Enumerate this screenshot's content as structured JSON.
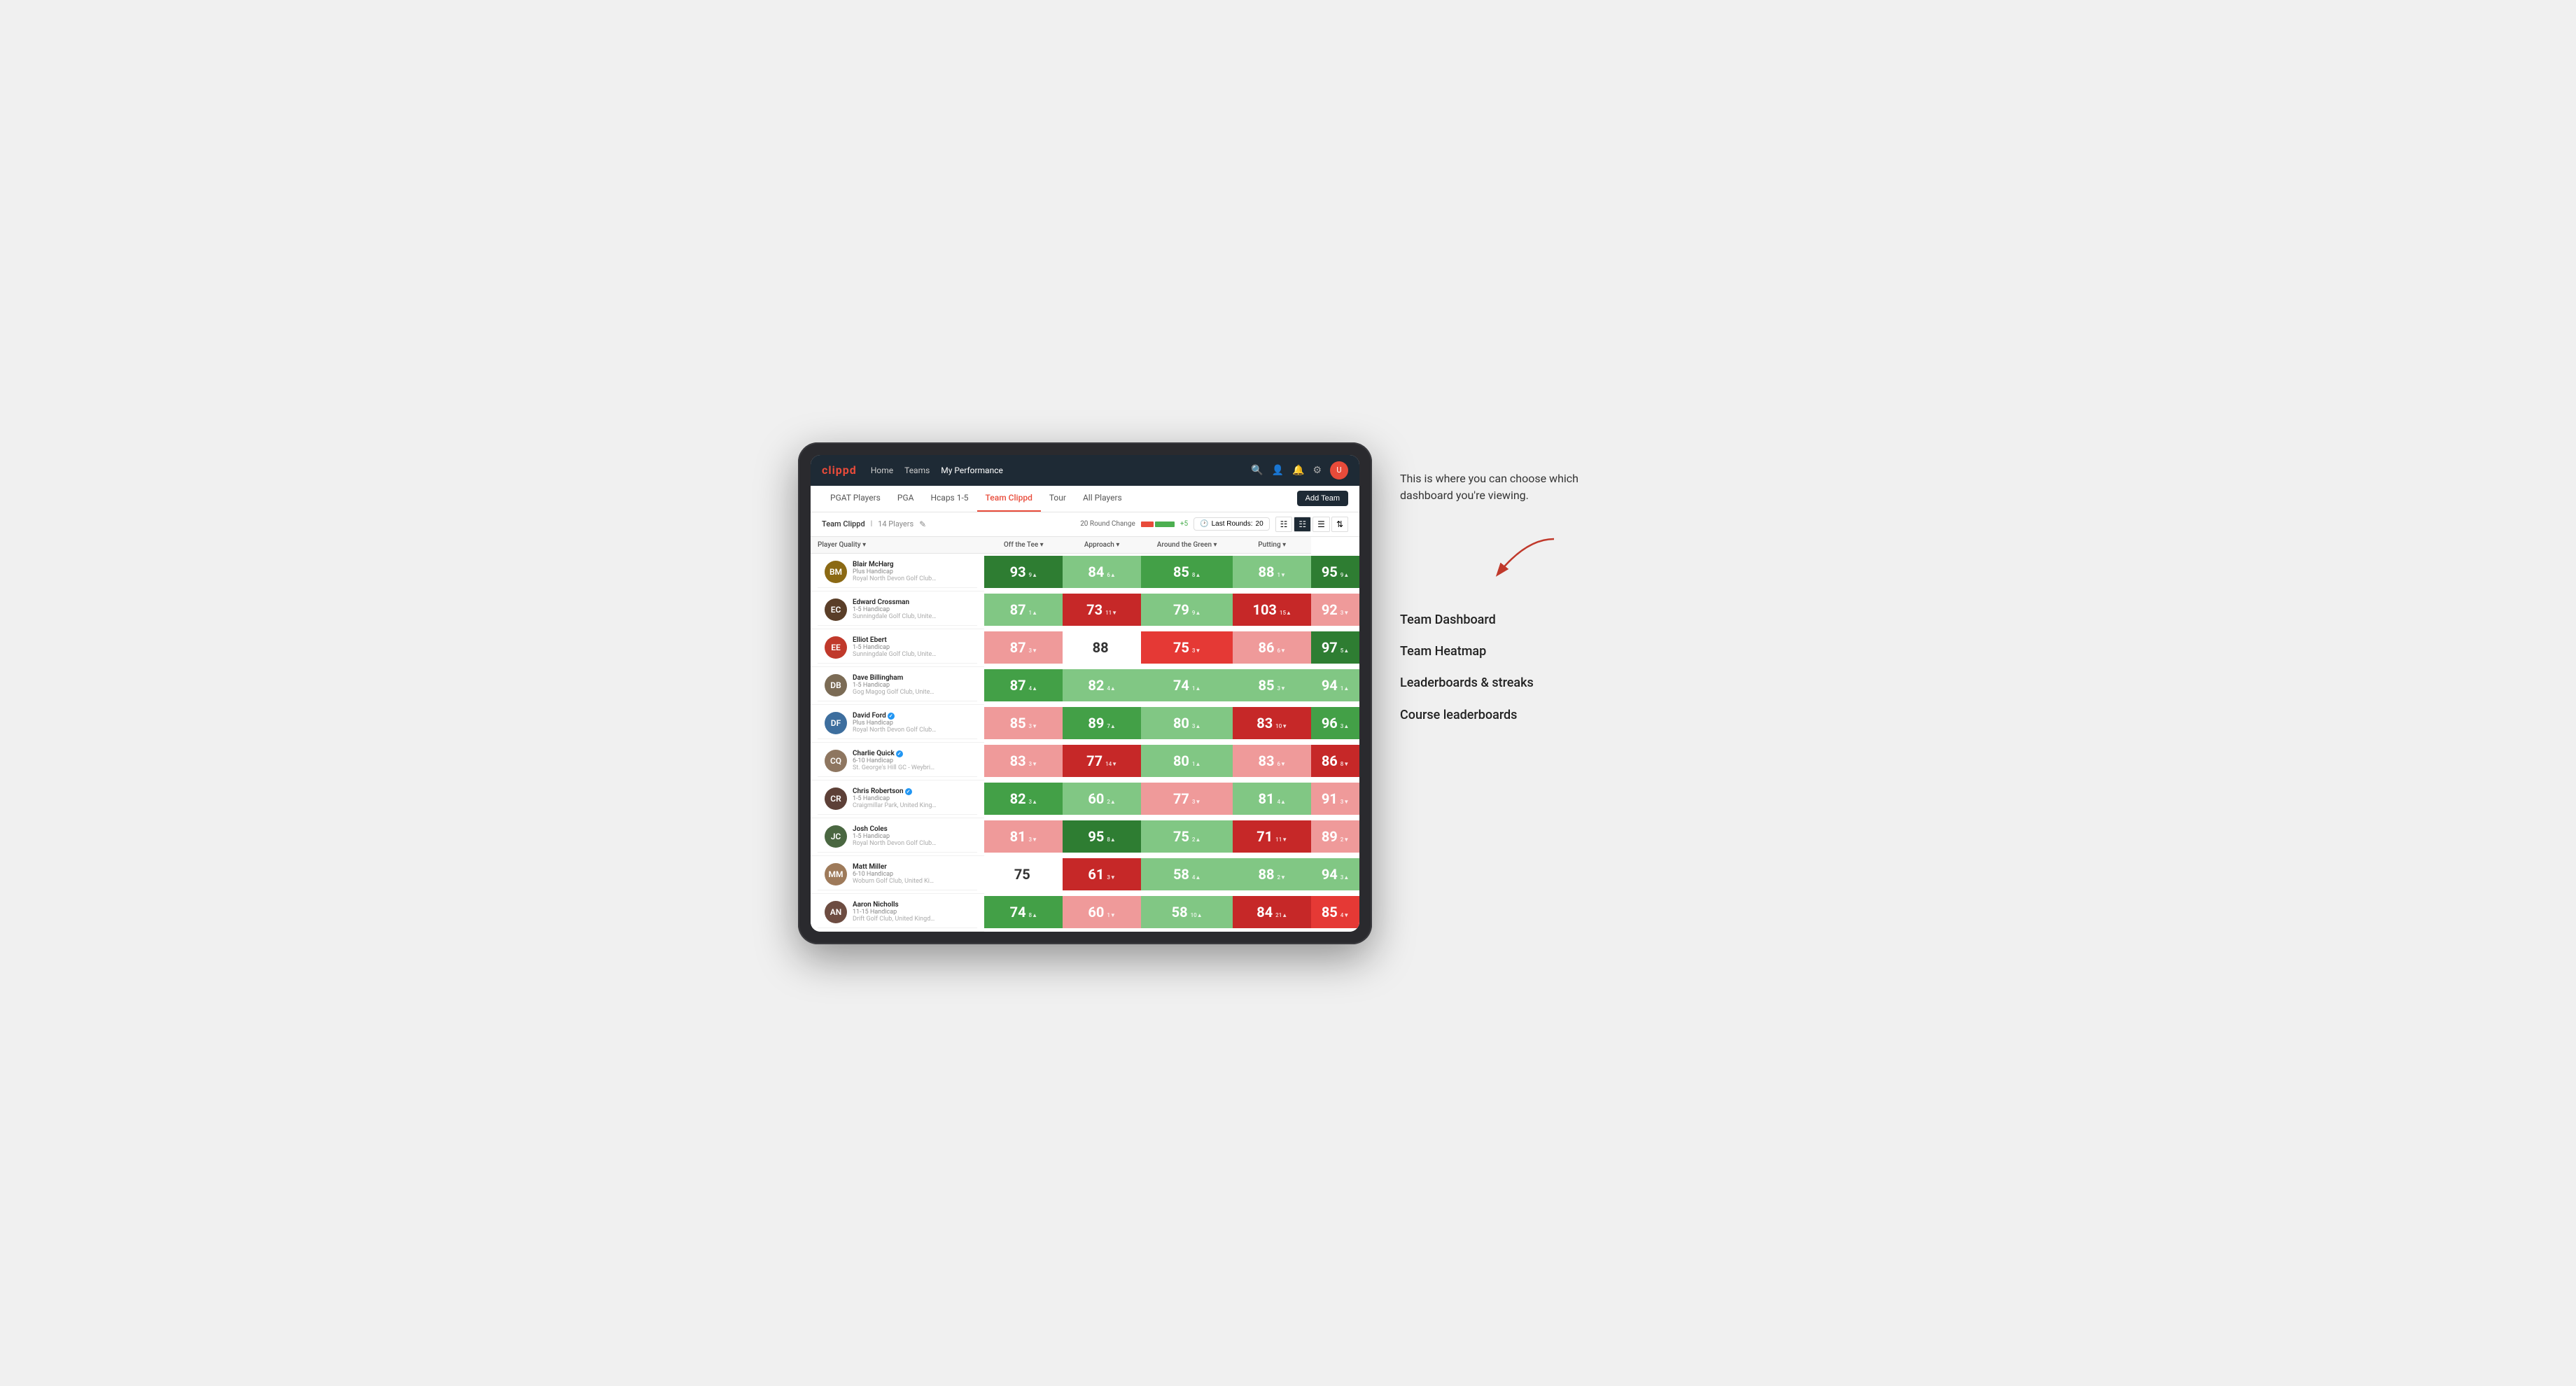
{
  "annotation": {
    "description": "This is where you can choose which dashboard you're viewing.",
    "items": [
      "Team Dashboard",
      "Team Heatmap",
      "Leaderboards & streaks",
      "Course leaderboards"
    ]
  },
  "nav": {
    "logo": "clippd",
    "links": [
      "Home",
      "Teams",
      "My Performance"
    ],
    "active_link": "My Performance"
  },
  "sub_nav": {
    "tabs": [
      "PGAT Players",
      "PGA",
      "Hcaps 1-5",
      "Team Clippd",
      "Tour",
      "All Players"
    ],
    "active_tab": "Team Clippd",
    "add_team_label": "Add Team"
  },
  "team_header": {
    "team_name": "Team Clippd",
    "player_count": "14 Players",
    "round_change_label": "20 Round Change",
    "round_change_neg": "-5",
    "round_change_pos": "+5",
    "last_rounds_label": "Last Rounds:",
    "last_rounds_value": "20"
  },
  "table": {
    "col_headers": [
      "Player Quality ▾",
      "Off the Tee ▾",
      "Approach ▾",
      "Around the Green ▾",
      "Putting ▾"
    ],
    "players": [
      {
        "name": "Blair McHarg",
        "handicap": "Plus Handicap",
        "club": "Royal North Devon Golf Club, United Kingdom",
        "avatar_color": "#8B6914",
        "scores": [
          {
            "value": "93",
            "change": "9",
            "dir": "up",
            "bg": "green-dark"
          },
          {
            "value": "84",
            "change": "6",
            "dir": "up",
            "bg": "green-light"
          },
          {
            "value": "85",
            "change": "8",
            "dir": "up",
            "bg": "green-med"
          },
          {
            "value": "88",
            "change": "1",
            "dir": "down",
            "bg": "green-light"
          },
          {
            "value": "95",
            "change": "9",
            "dir": "up",
            "bg": "green-dark"
          }
        ]
      },
      {
        "name": "Edward Crossman",
        "handicap": "1-5 Handicap",
        "club": "Sunningdale Golf Club, United Kingdom",
        "avatar_color": "#5a3e28",
        "scores": [
          {
            "value": "87",
            "change": "1",
            "dir": "up",
            "bg": "green-light"
          },
          {
            "value": "73",
            "change": "11",
            "dir": "down",
            "bg": "red-dark"
          },
          {
            "value": "79",
            "change": "9",
            "dir": "up",
            "bg": "green-light"
          },
          {
            "value": "103",
            "change": "15",
            "dir": "up",
            "bg": "red-dark"
          },
          {
            "value": "92",
            "change": "3",
            "dir": "down",
            "bg": "red-light"
          }
        ]
      },
      {
        "name": "Elliot Ebert",
        "handicap": "1-5 Handicap",
        "club": "Sunningdale Golf Club, United Kingdom",
        "avatar_color": "#c0392b",
        "scores": [
          {
            "value": "87",
            "change": "3",
            "dir": "down",
            "bg": "red-light"
          },
          {
            "value": "88",
            "change": "",
            "dir": "",
            "bg": "white"
          },
          {
            "value": "75",
            "change": "3",
            "dir": "down",
            "bg": "red-med"
          },
          {
            "value": "86",
            "change": "6",
            "dir": "down",
            "bg": "red-light"
          },
          {
            "value": "97",
            "change": "5",
            "dir": "up",
            "bg": "green-dark"
          }
        ]
      },
      {
        "name": "Dave Billingham",
        "handicap": "1-5 Handicap",
        "club": "Gog Magog Golf Club, United Kingdom",
        "avatar_color": "#7b6b55",
        "scores": [
          {
            "value": "87",
            "change": "4",
            "dir": "up",
            "bg": "green-med"
          },
          {
            "value": "82",
            "change": "4",
            "dir": "up",
            "bg": "green-light"
          },
          {
            "value": "74",
            "change": "1",
            "dir": "up",
            "bg": "green-light"
          },
          {
            "value": "85",
            "change": "3",
            "dir": "down",
            "bg": "green-light"
          },
          {
            "value": "94",
            "change": "1",
            "dir": "up",
            "bg": "green-light"
          }
        ]
      },
      {
        "name": "David Ford",
        "handicap": "Plus Handicap",
        "club": "Royal North Devon Golf Club, United Kingdom",
        "avatar_color": "#3d6e9e",
        "verified": true,
        "scores": [
          {
            "value": "85",
            "change": "3",
            "dir": "down",
            "bg": "red-light"
          },
          {
            "value": "89",
            "change": "7",
            "dir": "up",
            "bg": "green-med"
          },
          {
            "value": "80",
            "change": "3",
            "dir": "up",
            "bg": "green-light"
          },
          {
            "value": "83",
            "change": "10",
            "dir": "down",
            "bg": "red-dark"
          },
          {
            "value": "96",
            "change": "3",
            "dir": "up",
            "bg": "green-med"
          }
        ]
      },
      {
        "name": "Charlie Quick",
        "handicap": "6-10 Handicap",
        "club": "St. George's Hill GC - Weybridge - Surrey, Uni...",
        "avatar_color": "#8e7660",
        "verified": true,
        "scores": [
          {
            "value": "83",
            "change": "3",
            "dir": "down",
            "bg": "red-light"
          },
          {
            "value": "77",
            "change": "14",
            "dir": "down",
            "bg": "red-dark"
          },
          {
            "value": "80",
            "change": "1",
            "dir": "up",
            "bg": "green-light"
          },
          {
            "value": "83",
            "change": "6",
            "dir": "down",
            "bg": "red-light"
          },
          {
            "value": "86",
            "change": "8",
            "dir": "down",
            "bg": "red-dark"
          }
        ]
      },
      {
        "name": "Chris Robertson",
        "handicap": "1-5 Handicap",
        "club": "Craigmillar Park, United Kingdom",
        "avatar_color": "#5d4037",
        "verified": true,
        "scores": [
          {
            "value": "82",
            "change": "3",
            "dir": "up",
            "bg": "green-med"
          },
          {
            "value": "60",
            "change": "2",
            "dir": "up",
            "bg": "green-light"
          },
          {
            "value": "77",
            "change": "3",
            "dir": "down",
            "bg": "red-light"
          },
          {
            "value": "81",
            "change": "4",
            "dir": "up",
            "bg": "green-light"
          },
          {
            "value": "91",
            "change": "3",
            "dir": "down",
            "bg": "red-light"
          }
        ]
      },
      {
        "name": "Josh Coles",
        "handicap": "1-5 Handicap",
        "club": "Royal North Devon Golf Club, United Kingdom",
        "avatar_color": "#4a6741",
        "scores": [
          {
            "value": "81",
            "change": "3",
            "dir": "down",
            "bg": "red-light"
          },
          {
            "value": "95",
            "change": "8",
            "dir": "up",
            "bg": "green-dark"
          },
          {
            "value": "75",
            "change": "2",
            "dir": "up",
            "bg": "green-light"
          },
          {
            "value": "71",
            "change": "11",
            "dir": "down",
            "bg": "red-dark"
          },
          {
            "value": "89",
            "change": "2",
            "dir": "down",
            "bg": "red-light"
          }
        ]
      },
      {
        "name": "Matt Miller",
        "handicap": "6-10 Handicap",
        "club": "Woburn Golf Club, United Kingdom",
        "avatar_color": "#9e7a5a",
        "scores": [
          {
            "value": "75",
            "change": "",
            "dir": "",
            "bg": "white"
          },
          {
            "value": "61",
            "change": "3",
            "dir": "down",
            "bg": "red-dark"
          },
          {
            "value": "58",
            "change": "4",
            "dir": "up",
            "bg": "green-light"
          },
          {
            "value": "88",
            "change": "2",
            "dir": "down",
            "bg": "green-light"
          },
          {
            "value": "94",
            "change": "3",
            "dir": "up",
            "bg": "green-light"
          }
        ]
      },
      {
        "name": "Aaron Nicholls",
        "handicap": "11-15 Handicap",
        "club": "Drift Golf Club, United Kingdom",
        "avatar_color": "#6d4c41",
        "scores": [
          {
            "value": "74",
            "change": "8",
            "dir": "up",
            "bg": "green-med"
          },
          {
            "value": "60",
            "change": "1",
            "dir": "down",
            "bg": "red-light"
          },
          {
            "value": "58",
            "change": "10",
            "dir": "up",
            "bg": "green-light"
          },
          {
            "value": "84",
            "change": "21",
            "dir": "up",
            "bg": "red-dark"
          },
          {
            "value": "85",
            "change": "4",
            "dir": "down",
            "bg": "red-med"
          }
        ]
      }
    ]
  }
}
